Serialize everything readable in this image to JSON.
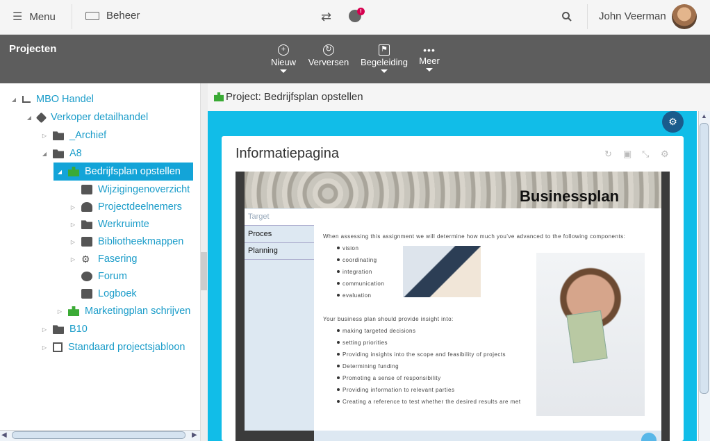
{
  "topbar": {
    "menu_label": "Menu",
    "beheer_label": "Beheer",
    "alert_count": "!",
    "user_name": "John Veerman"
  },
  "toolbar": {
    "page_title": "Projecten",
    "tools": [
      "Nieuw",
      "Verversen",
      "Begeleiding",
      "Meer"
    ]
  },
  "tree": {
    "nodes": [
      "MBO Handel",
      "Verkoper detailhandel",
      "_Archief",
      "A8",
      "Bedrijfsplan opstellen",
      "Wijzigingenoverzicht",
      "Projectdeelnemers",
      "Werkruimte",
      "Bibliotheekmappen",
      "Fasering",
      "Forum",
      "Logboek",
      "Marketingplan schrijven",
      "B10",
      "Standaard projectsjabloon"
    ]
  },
  "breadcrumb": "Project: Bedrijfsplan opstellen",
  "panel": {
    "title": "Informatiepagina",
    "banner_title": "Businessplan",
    "subnav": [
      "Target",
      "Proces",
      "Planning"
    ],
    "intro1": "When assessing this assignment we will determine how much you've advanced to the following components:",
    "list1": [
      "vision",
      "coordinating",
      "integration",
      "communication",
      "evaluation"
    ],
    "intro2": "Your business plan should provide insight into:",
    "list2": [
      "making targeted decisions",
      "setting priorities",
      "Providing insights into the scope and feasibility of projects",
      "Determining funding",
      "Promoting a sense of responsibility",
      "Providing information to relevant parties",
      "Creating a reference to test whether the desired results are met"
    ]
  },
  "colors": {
    "accent": "#13a4d8",
    "panel_bg": "#11bde8",
    "toolbar_bg": "#5d5d5d",
    "link": "#1a9cc9",
    "puzzle": "#3aaa35"
  }
}
